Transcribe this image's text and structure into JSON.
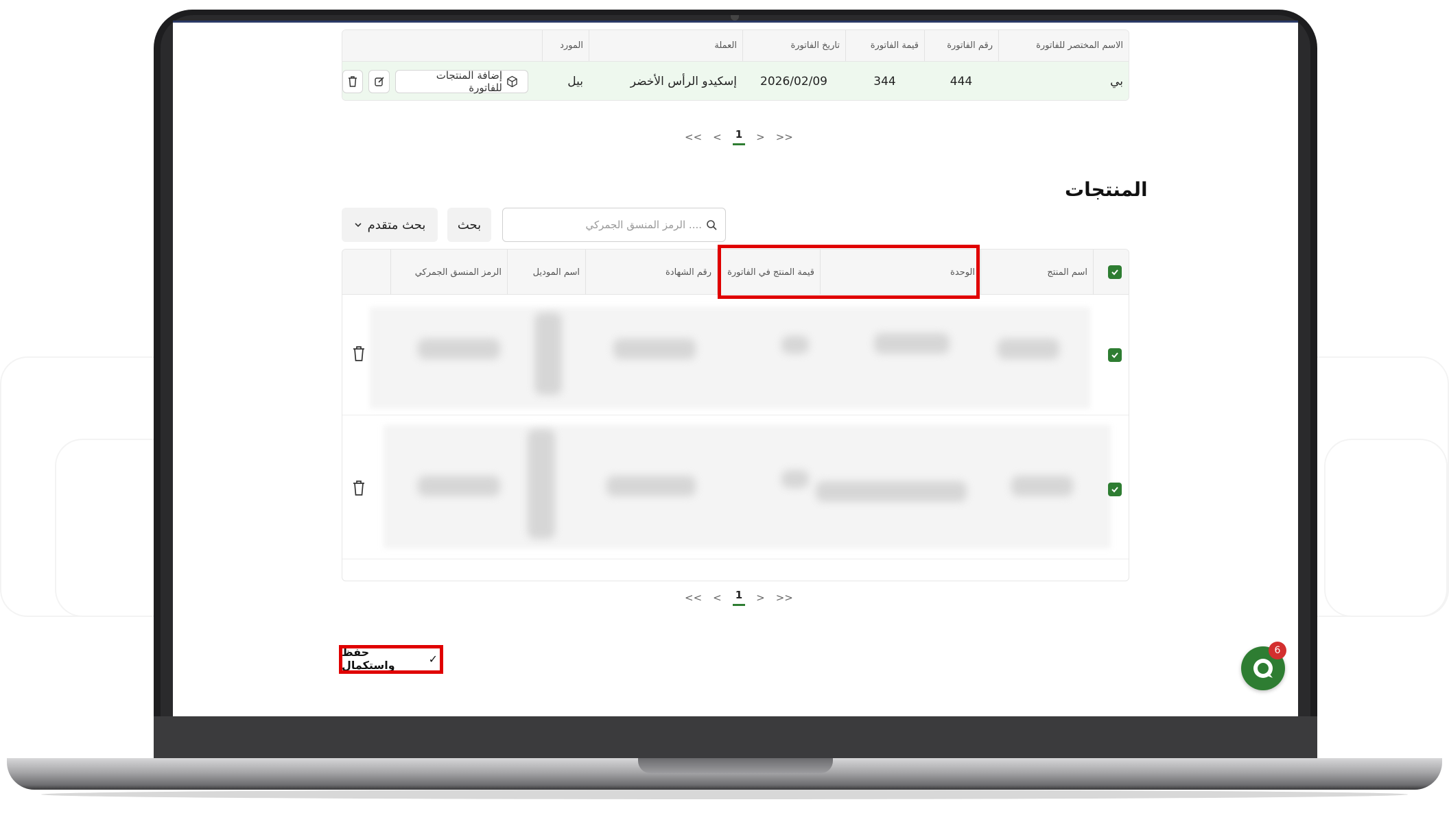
{
  "invoices_table": {
    "headers": {
      "short_name": "الاسم المختصر للفاتورة",
      "invoice_number": "رقم الفاتورة",
      "invoice_value": "قيمة الفاتورة",
      "invoice_date": "تاريخ الفاتورة",
      "currency": "العملة",
      "supplier": "المورد"
    },
    "row": {
      "short_name": "بي",
      "invoice_number": "444",
      "invoice_value": "344",
      "invoice_date": "2026/02/09",
      "currency": "إسكيدو الرأس الأخضر",
      "supplier": "بيل",
      "add_products_label": "إضافة المنتجات للفاتورة"
    }
  },
  "pagination_top": {
    "first": "<<",
    "prev": "<",
    "current": "1",
    "next": ">",
    "last": ">>"
  },
  "products_section": {
    "title": "المنتجات",
    "search_placeholder": "الرمز المنسق الجمركي ....",
    "search_button": "بحث",
    "advanced_search_button": "بحث متقدم",
    "headers": {
      "product_name": "اسم المنتج",
      "unit": "الوحدة",
      "product_value_in_invoice": "قيمة المنتج في الفاتورة",
      "certificate_number": "رقم الشهادة",
      "model_name": "اسم الموديل",
      "hs_code": "الرمز المنسق الجمركي"
    }
  },
  "pagination_bottom": {
    "first": "<<",
    "prev": "<",
    "current": "1",
    "next": ">",
    "last": ">>"
  },
  "save_button": "حفظ واستكمال",
  "chat": {
    "badge_count": "6"
  },
  "colors": {
    "accent_green": "#2e7d32",
    "highlight_red": "#e00000",
    "row_highlight": "#eef8ee",
    "badge_red": "#d32f2f"
  }
}
